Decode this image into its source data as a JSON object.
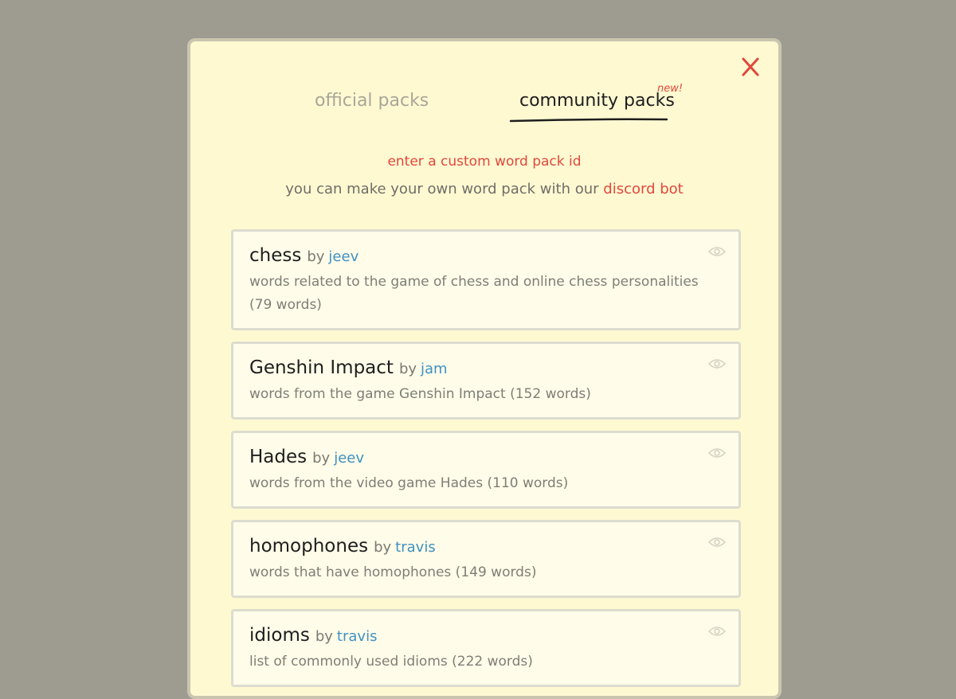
{
  "tabs": {
    "official_label": "official packs",
    "community_label": "community packs",
    "new_badge": "new!"
  },
  "header": {
    "custom_id_link": "enter a custom word pack id",
    "info_prefix": "you can make your own word pack with our ",
    "info_link": "discord bot"
  },
  "icons": {
    "close": "close-icon",
    "view": "eye-icon"
  },
  "colors": {
    "accent_red": "#e0483c",
    "author_blue": "#3f92c2",
    "background": "#9e9c91",
    "panel": "#fff9d2"
  },
  "packs": [
    {
      "name": "chess",
      "by": "by",
      "author": "jeev",
      "description": "words related to the game of chess and online chess personalities (79 words)"
    },
    {
      "name": "Genshin Impact",
      "by": "by",
      "author": "jam",
      "description": "words from the game Genshin Impact (152 words)"
    },
    {
      "name": "Hades",
      "by": "by",
      "author": "jeev",
      "description": "words from the video game Hades (110 words)"
    },
    {
      "name": "homophones",
      "by": "by",
      "author": "travis",
      "description": "words that have homophones (149 words)"
    },
    {
      "name": "idioms",
      "by": "by",
      "author": "travis",
      "description": "list of commonly used idioms (222 words)"
    }
  ]
}
